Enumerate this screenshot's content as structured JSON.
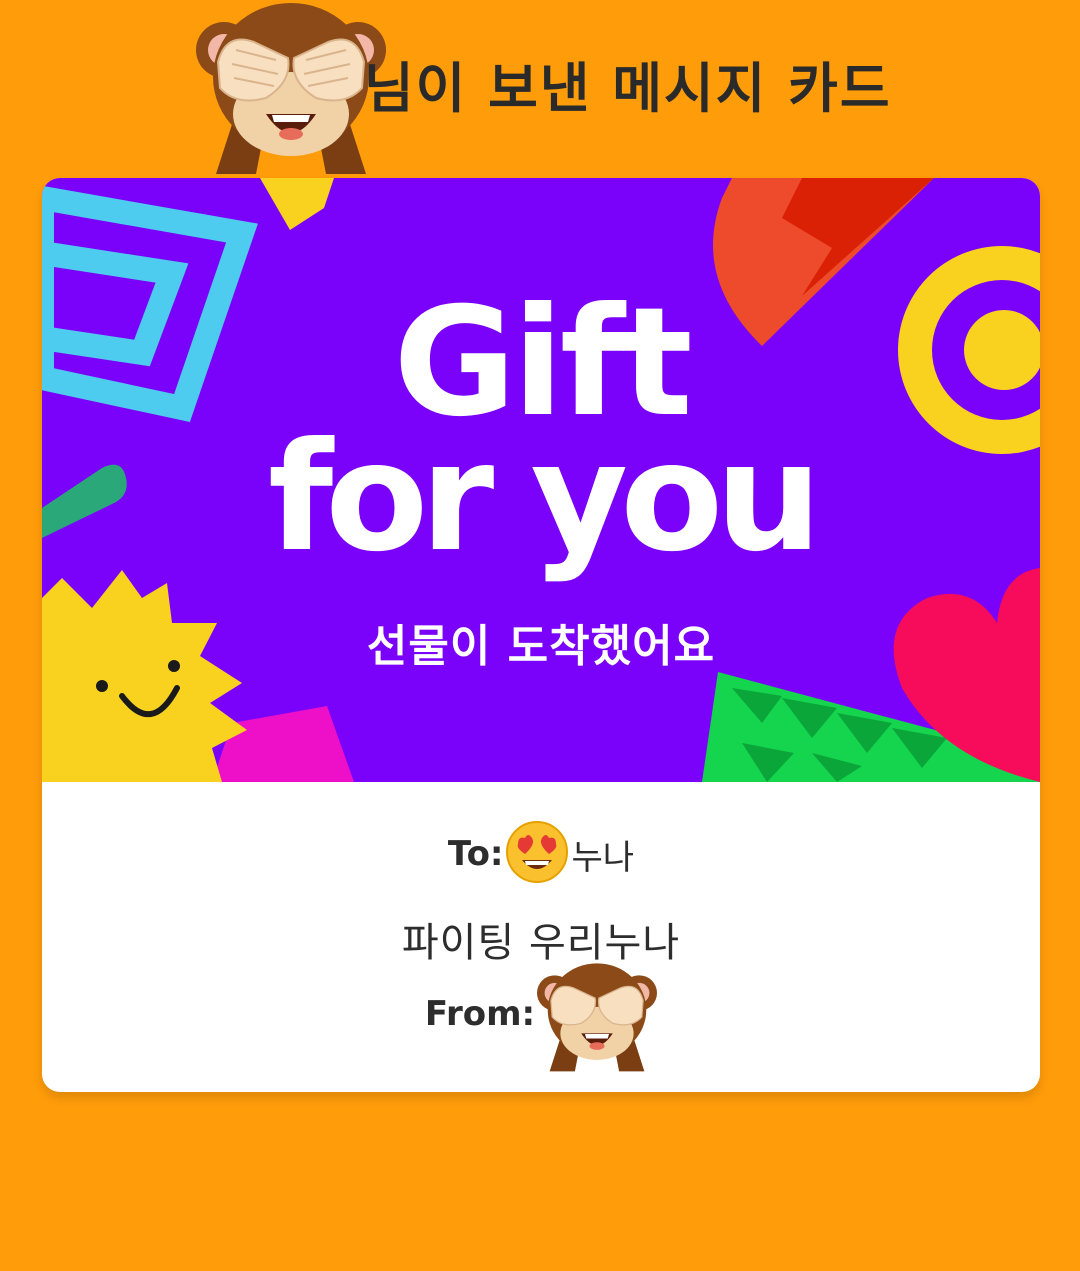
{
  "header": {
    "title": "님이 보낸 메시지 카드",
    "sender_emoji": "see-no-evil-monkey-icon"
  },
  "card": {
    "banner": {
      "headline_line1": "Gift",
      "headline_line2": "for you",
      "subtitle": "선물이 도착했어요",
      "background_color": "#7B02FA"
    },
    "to_label": "To:",
    "to_emoji": "heart-eyes-face-icon",
    "to_name": "누나",
    "message": "파이팅 우리누나",
    "from_label": "From:",
    "from_emoji": "see-no-evil-monkey-icon"
  },
  "colors": {
    "page_background": "#FF9C0A",
    "card_background": "#FFFFFF",
    "text": "#2D2D2D"
  }
}
